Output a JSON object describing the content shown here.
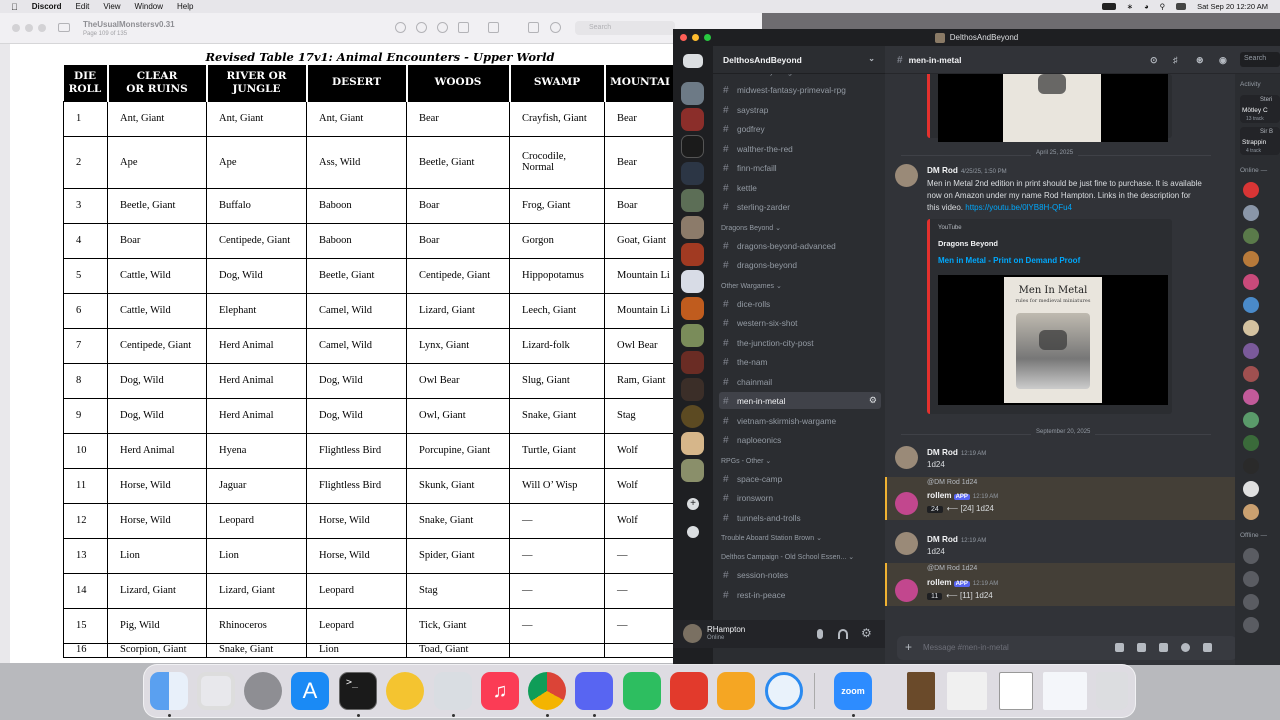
{
  "menubar": {
    "apple": "",
    "app_name": "Discord",
    "menus": [
      "Edit",
      "View",
      "Window",
      "Help"
    ],
    "clock": "Sat Sep 20  12:20 AM"
  },
  "preview": {
    "title": "TheUsualMonstersv0.31",
    "subtitle": "Page 109 of 135",
    "search_placeholder": "Search",
    "doc_title": "Revised Table 17v1: Animal Encounters - Upper World",
    "columns": [
      "DIE\nROLL",
      "CLEAR\nOR RUINS",
      "RIVER OR\nJUNGLE",
      "DESERT",
      "WOODS",
      "SWAMP",
      "MOUNTAI"
    ],
    "rows": [
      [
        "1",
        "Ant, Giant",
        "Ant, Giant",
        "Ant, Giant",
        "Bear",
        "Crayfish, Giant",
        "Bear"
      ],
      [
        "2",
        "Ape",
        "Ape",
        "Ass, Wild",
        "Beetle, Giant",
        "Crocodile,\nNormal",
        "Bear"
      ],
      [
        "3",
        "Beetle, Giant",
        "Buffalo",
        "Baboon",
        "Boar",
        "Frog, Giant",
        "Boar"
      ],
      [
        "4",
        "Boar",
        "Centipede, Giant",
        "Baboon",
        "Boar",
        "Gorgon",
        "Goat, Giant"
      ],
      [
        "5",
        "Cattle, Wild",
        "Dog, Wild",
        "Beetle, Giant",
        "Centipede, Giant",
        "Hippopotamus",
        "Mountain Li"
      ],
      [
        "6",
        "Cattle, Wild",
        "Elephant",
        "Camel, Wild",
        "Lizard, Giant",
        "Leech, Giant",
        "Mountain Li"
      ],
      [
        "7",
        "Centipede, Giant",
        "Herd Animal",
        "Camel, Wild",
        "Lynx, Giant",
        "Lizard-folk",
        "Owl Bear"
      ],
      [
        "8",
        "Dog, Wild",
        "Herd Animal",
        "Dog, Wild",
        "Owl Bear",
        "Slug, Giant",
        "Ram, Giant"
      ],
      [
        "9",
        "Dog, Wild",
        "Herd Animal",
        "Dog, Wild",
        "Owl, Giant",
        "Snake, Giant",
        "Stag"
      ],
      [
        "10",
        "Herd Animal",
        "Hyena",
        "Flightless Bird",
        "Porcupine, Giant",
        "Turtle, Giant",
        "Wolf"
      ],
      [
        "11",
        "Horse, Wild",
        "Jaguar",
        "Flightless Bird",
        "Skunk, Giant",
        "Will O’ Wisp",
        "Wolf"
      ],
      [
        "12",
        "Horse, Wild",
        "Leopard",
        "Horse, Wild",
        "Snake, Giant",
        "—",
        "Wolf"
      ],
      [
        "13",
        "Lion",
        "Lion",
        "Horse, Wild",
        "Spider, Giant",
        "—",
        "—"
      ],
      [
        "14",
        "Lizard, Giant",
        "Lizard, Giant",
        "Leopard",
        "Stag",
        "—",
        "—"
      ],
      [
        "15",
        "Pig, Wild",
        "Rhinoceros",
        "Leopard",
        "Tick, Giant",
        "—",
        "—"
      ],
      [
        "16",
        "Scorpion, Giant",
        "Snake, Giant",
        "Lion",
        "Toad, Giant",
        "",
        ""
      ]
    ]
  },
  "discord": {
    "window_title": "DelthosAndBeyond",
    "server_name": "DelthosAndBeyond",
    "channels": [
      {
        "type": "cat",
        "label": "Midwest Fantasy Wargame"
      },
      {
        "type": "ch",
        "label": "midwest-fantasy-primeval-rpg"
      },
      {
        "type": "ch",
        "label": "saystrap"
      },
      {
        "type": "ch",
        "label": "godfrey"
      },
      {
        "type": "ch",
        "label": "walther-the-red"
      },
      {
        "type": "ch",
        "label": "finn-mcfaill"
      },
      {
        "type": "ch",
        "label": "kettle"
      },
      {
        "type": "ch",
        "label": "sterling-zarder"
      },
      {
        "type": "cat",
        "label": "Dragons Beyond"
      },
      {
        "type": "ch",
        "label": "dragons-beyond-advanced"
      },
      {
        "type": "ch",
        "label": "dragons-beyond"
      },
      {
        "type": "cat",
        "label": "Other Wargames"
      },
      {
        "type": "ch",
        "label": "dice-rolls"
      },
      {
        "type": "ch",
        "label": "western-six-shot"
      },
      {
        "type": "ch",
        "label": "the-junction-city-post"
      },
      {
        "type": "ch",
        "label": "the-nam"
      },
      {
        "type": "ch",
        "label": "chainmail"
      },
      {
        "type": "ch",
        "label": "men-in-metal",
        "active": true
      },
      {
        "type": "ch",
        "label": "vietnam-skirmish-wargame"
      },
      {
        "type": "ch",
        "label": "naploeonics"
      },
      {
        "type": "cat",
        "label": "RPGs - Other"
      },
      {
        "type": "ch",
        "label": "space-camp"
      },
      {
        "type": "ch",
        "label": "ironsworn"
      },
      {
        "type": "ch",
        "label": "tunnels-and-trolls"
      },
      {
        "type": "cat",
        "label": "Trouble Aboard Station Brown"
      },
      {
        "type": "cat",
        "label": "Delthos Campaign - Old School Essen..."
      },
      {
        "type": "ch",
        "label": "session-notes"
      },
      {
        "type": "ch",
        "label": "rest-in-peace"
      }
    ],
    "current_channel": "men-in-metal",
    "user": {
      "name": "RHampton",
      "status": "Online"
    },
    "date1": "April 25, 2025",
    "msg1": {
      "author": "DM Rod",
      "time": "4/25/25, 1:50 PM",
      "text": "Men in Metal 2nd edition in print should be just fine to purchase.  It is available now on Amazon under my name Rod Hampton.  Links in the description for this video.",
      "link": "https://youtu.be/0lYB8H-QFu4",
      "embed_provider": "YouTube",
      "embed_author": "Dragons Beyond",
      "embed_title": "Men in Metal - Print on Demand Proof",
      "cover_title": "Men In Metal",
      "cover_sub": "rules for medieval miniatures"
    },
    "date2": "September 20, 2025",
    "msg2": {
      "author": "DM Rod",
      "time": "12:19 AM",
      "text": "1d24"
    },
    "bot1": {
      "reply": "@DM Rod 1d24",
      "author": "rollem",
      "badge": "APP",
      "time": "12:19 AM",
      "value": "24",
      "result": "⟵ [24] 1d24"
    },
    "msg3": {
      "author": "DM Rod",
      "time": "12:19 AM",
      "text": "1d24"
    },
    "bot2": {
      "reply": "@DM Rod 1d24",
      "author": "rollem",
      "badge": "APP",
      "time": "12:19 AM",
      "value": "11",
      "result": "⟵ [11] 1d24"
    },
    "composer_placeholder": "Message #men-in-metal",
    "search_label": "Search",
    "members": {
      "activity": "Activity",
      "online": "Online —",
      "offline": "Offline —",
      "act1": "Mötley C",
      "act1_sub": "13 track",
      "act2": "Strappin",
      "act2_sub": "4 track",
      "act1_name": "Steri",
      "act2_name": "Sir B"
    }
  },
  "dock": {
    "apps": [
      "Finder",
      "Launchpad",
      "System Settings",
      "App Store",
      "Terminal",
      "Artstudio",
      "Preview",
      "Music",
      "Chrome",
      "Discord",
      "Evernote",
      "Gondola",
      "Pages",
      "Safari",
      "Zoom"
    ],
    "zoom_label": "zoom"
  }
}
